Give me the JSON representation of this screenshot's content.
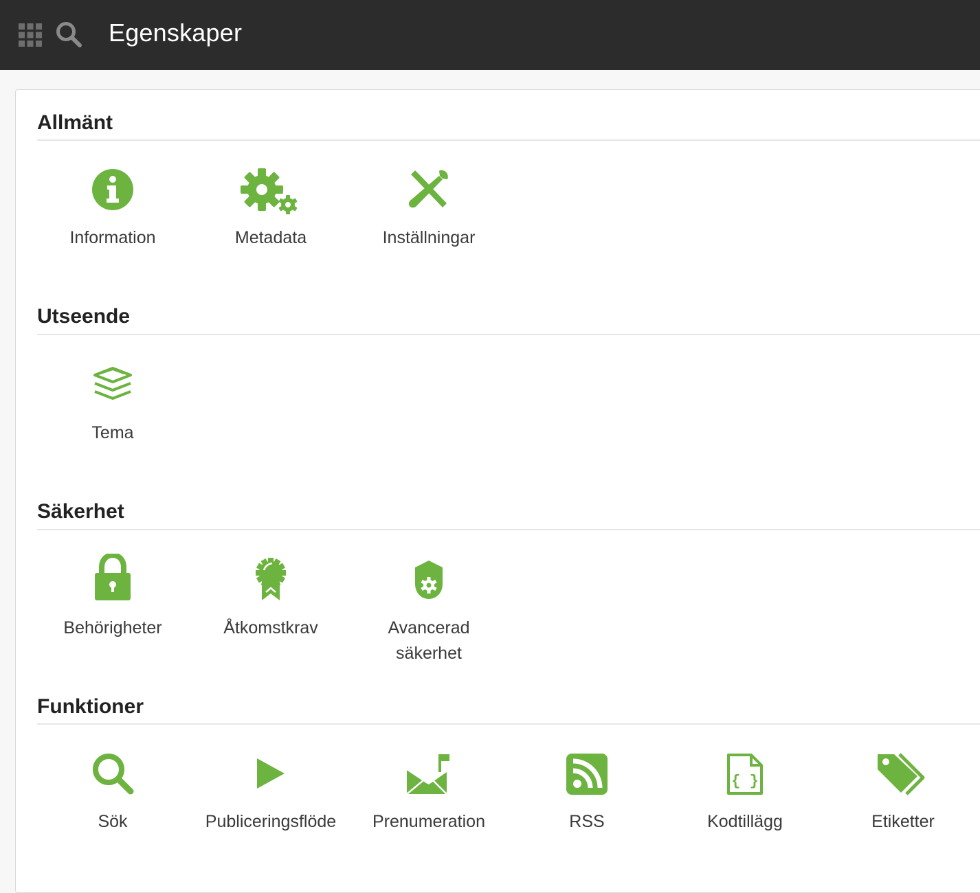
{
  "header": {
    "title": "Egenskaper",
    "apps_icon": "grid-icon",
    "search_icon": "search-icon"
  },
  "theme": {
    "accent": "#6db33f",
    "topbar": "#2c2c2c"
  },
  "sections": [
    {
      "title": "Allmänt",
      "items": [
        {
          "label": "Information",
          "icon": "info-icon"
        },
        {
          "label": "Metadata",
          "icon": "gears-icon"
        },
        {
          "label": "Inställningar",
          "icon": "tools-icon"
        }
      ]
    },
    {
      "title": "Utseende",
      "items": [
        {
          "label": "Tema",
          "icon": "layers-icon"
        }
      ]
    },
    {
      "title": "Säkerhet",
      "items": [
        {
          "label": "Behörigheter",
          "icon": "lock-icon"
        },
        {
          "label": "Åtkomstkrav",
          "icon": "award-icon"
        },
        {
          "label_line1": "Avancerad",
          "label_line2": "säkerhet",
          "icon": "shield-gear-icon"
        }
      ]
    },
    {
      "title": "Funktioner",
      "items": [
        {
          "label": "Sök",
          "icon": "search-icon"
        },
        {
          "label": "Publiceringsflöde",
          "icon": "play-icon"
        },
        {
          "label": "Prenumeration",
          "icon": "envelope-flag-icon"
        },
        {
          "label": "RSS",
          "icon": "rss-icon"
        },
        {
          "label": "Kodtillägg",
          "icon": "code-file-icon"
        },
        {
          "label": "Etiketter",
          "icon": "tags-icon"
        }
      ]
    }
  ]
}
